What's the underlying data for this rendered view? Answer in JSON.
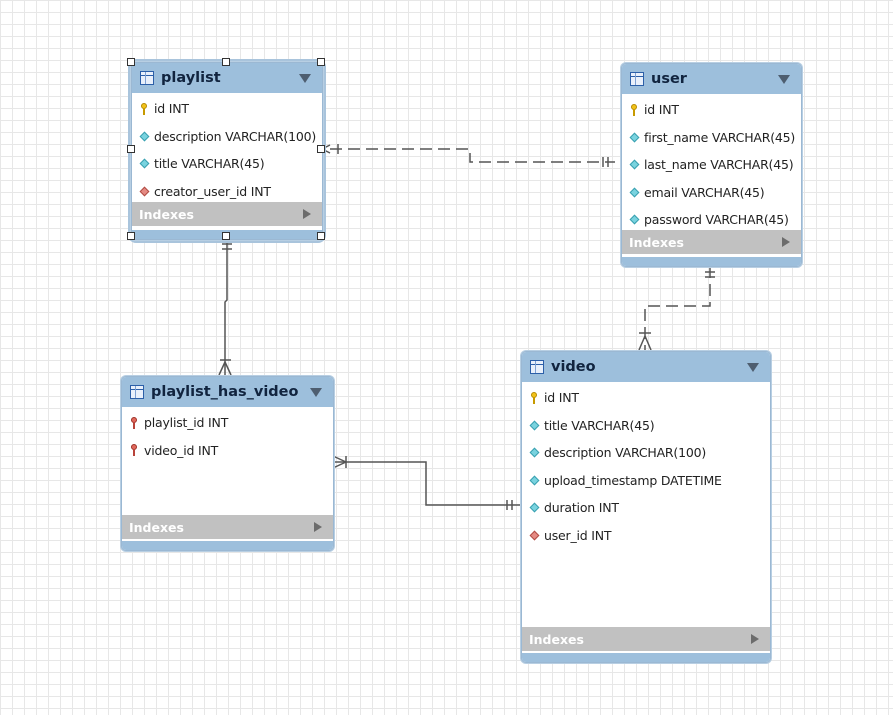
{
  "tables": {
    "playlist": {
      "name": "playlist",
      "columns": [
        {
          "text": "id INT",
          "kind": "pk"
        },
        {
          "text": "description VARCHAR(100)",
          "kind": "column"
        },
        {
          "text": "title VARCHAR(45)",
          "kind": "column"
        },
        {
          "text": "creator_user_id INT",
          "kind": "fk"
        }
      ],
      "indexes_label": "Indexes"
    },
    "user": {
      "name": "user",
      "columns": [
        {
          "text": "id INT",
          "kind": "pk"
        },
        {
          "text": "first_name VARCHAR(45)",
          "kind": "column"
        },
        {
          "text": "last_name VARCHAR(45)",
          "kind": "column"
        },
        {
          "text": "email VARCHAR(45)",
          "kind": "column"
        },
        {
          "text": "password VARCHAR(45)",
          "kind": "column"
        }
      ],
      "indexes_label": "Indexes"
    },
    "playlist_has_video": {
      "name": "playlist_has_video",
      "columns": [
        {
          "text": "playlist_id INT",
          "kind": "pk-fk"
        },
        {
          "text": "video_id INT",
          "kind": "pk-fk"
        }
      ],
      "indexes_label": "Indexes"
    },
    "video": {
      "name": "video",
      "columns": [
        {
          "text": "id INT",
          "kind": "pk"
        },
        {
          "text": "title VARCHAR(45)",
          "kind": "column"
        },
        {
          "text": "description VARCHAR(100)",
          "kind": "column"
        },
        {
          "text": "upload_timestamp DATETIME",
          "kind": "column"
        },
        {
          "text": "duration INT",
          "kind": "column"
        },
        {
          "text": "user_id INT",
          "kind": "fk"
        }
      ],
      "indexes_label": "Indexes"
    }
  },
  "colors": {
    "header": "#9dbfdc",
    "indexes_bar": "#c1c1c1",
    "connector": "#555555",
    "grid": "#e7e7e7"
  },
  "icons": {
    "table": "table-icon",
    "primary_key": "key-icon",
    "foreign_key": "foreign-key-icon",
    "column": "diamond-icon",
    "collapse": "collapse-arrow-icon",
    "expand": "expand-arrow-icon"
  },
  "relationships": [
    {
      "from": "playlist",
      "to": "user",
      "style": "dashed",
      "from_end": "zero-or-many",
      "to_end": "one-and-only-one"
    },
    {
      "from": "playlist",
      "to": "playlist_has_video",
      "style": "solid",
      "from_end": "one-and-only-one",
      "to_end": "one-or-many"
    },
    {
      "from": "user",
      "to": "video",
      "style": "dashed",
      "from_end": "one-and-only-one",
      "to_end": "one-or-many"
    },
    {
      "from": "playlist_has_video",
      "to": "video",
      "style": "solid",
      "from_end": "one-or-many",
      "to_end": "one-and-only-one"
    }
  ]
}
